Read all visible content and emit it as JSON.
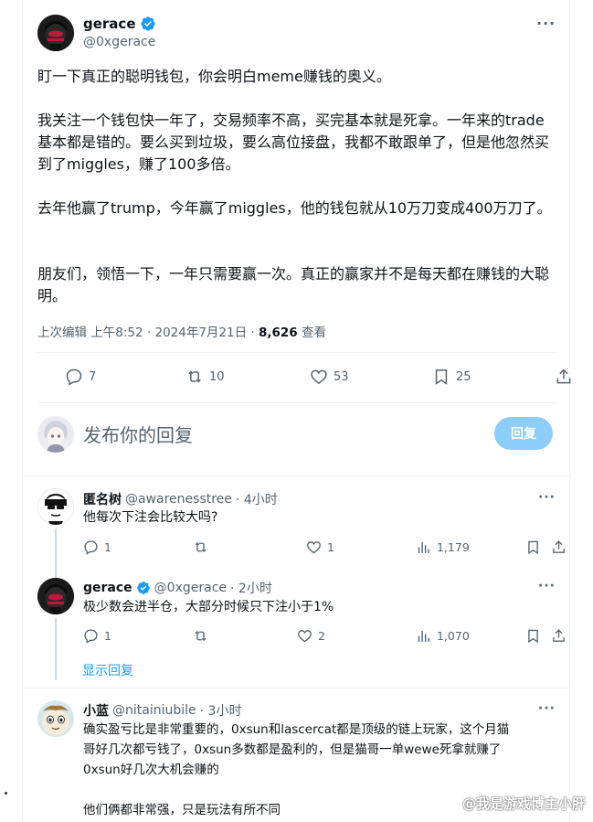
{
  "tweet": {
    "author_name": "gerace",
    "author_handle": "@0xgerace",
    "paragraphs": [
      "盯一下真正的聪明钱包，你会明白meme赚钱的奥义。",
      "我关注一个钱包快一年了，交易频率不高，买完基本就是死拿。一年来的trade基本都是错的。要么买到垃圾，要么高位接盘，我都不敢跟单了，但是他忽然买到了miggles，赚了100多倍。",
      "去年他赢了trump，今年赢了miggles，他的钱包就从10万刀变成400万刀了。",
      "朋友们，领悟一下，一年只需要赢一次。真正的赢家并不是每天都在赚钱的大聪明。"
    ],
    "meta_prefix": "上次编辑 上午8:52 · 2024年7月21日 · ",
    "views": "8,626",
    "views_label": "查看",
    "stats": {
      "replies": "7",
      "retweets": "10",
      "likes": "53",
      "bookmarks": "25"
    }
  },
  "composer": {
    "placeholder": "发布你的回复",
    "button_label": "回复"
  },
  "replies": [
    {
      "name": "匿名树",
      "handle": "@awarenesstree",
      "time": "· 4小时",
      "text": "他每次下注会比较大吗?",
      "replies": "1",
      "retweets": "",
      "likes": "1",
      "views": "1,179"
    },
    {
      "name": "gerace",
      "handle": "@0xgerace",
      "time": "· 2小时",
      "text": "极少数会进半仓，大部分时候只下注小于1%",
      "replies": "1",
      "retweets": "",
      "likes": "2",
      "views": "1,070"
    },
    {
      "name": "小蓝",
      "handle": "@nitainiubile",
      "time": "· 3小时",
      "text_lines": [
        "确实盈亏比是非常重要的，0xsun和lascercat都是顶级的链上玩家，这个月猫",
        "哥好几次都亏钱了，0xsun多数都是盈利的，但是猫哥一单wewe死拿就赚了",
        "0xsun好几次大机会赚的",
        "",
        "他们俩都非常强，只是玩法有所不同"
      ]
    }
  ],
  "show_replies_label": "显示回复",
  "watermark": "@我是游戏博主小肝",
  "colors": {
    "accent": "#1d9bf0",
    "reply_button": "#8ecdf7",
    "secondary_text": "#536471"
  }
}
